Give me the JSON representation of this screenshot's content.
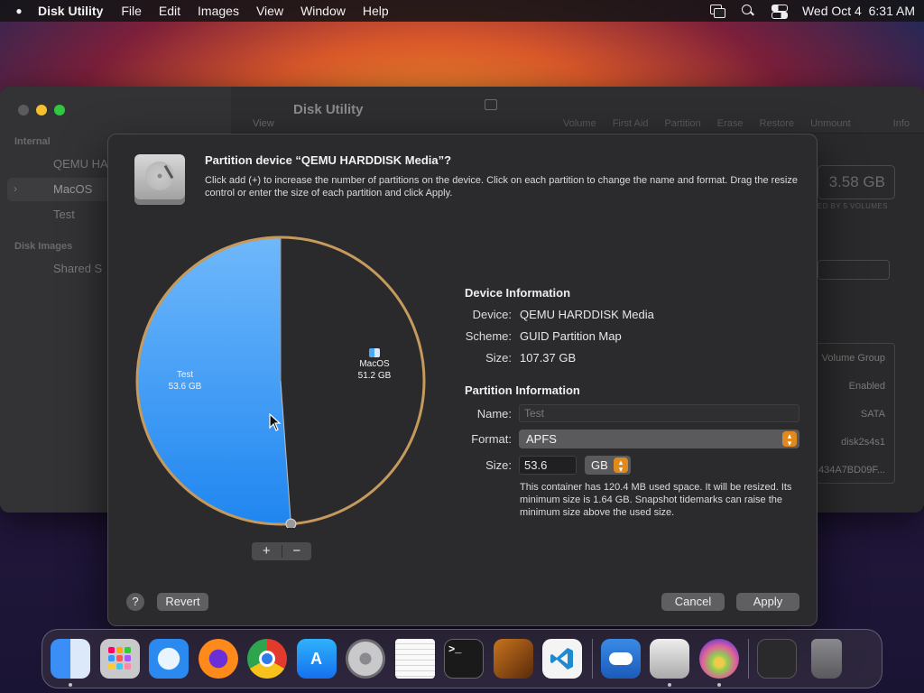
{
  "menubar": {
    "app_name": "Disk Utility",
    "items": [
      "File",
      "Edit",
      "Images",
      "View",
      "Window",
      "Help"
    ],
    "clock": "Wed Oct 4  6:31 AM"
  },
  "background_window": {
    "title": "Disk Utility",
    "view_label": "View",
    "toolbar_items": [
      "Volume",
      "First Aid",
      "Partition",
      "Erase",
      "Restore",
      "Unmount"
    ],
    "info_label": "Info",
    "sidebar": {
      "internal_header": "Internal",
      "items": [
        "QEMU HA",
        "MacOS",
        "Test"
      ],
      "images_header": "Disk Images",
      "image_items": [
        "Shared S"
      ]
    },
    "capacity_text": "3.58 GB",
    "shared_text": "ED BY 5 VOLUMES",
    "info_cells": [
      "Volume Group",
      "Enabled",
      "SATA",
      "disk2s4s1",
      "434A7BD09F..."
    ]
  },
  "sheet": {
    "title": "Partition device “QEMU HARDDISK Media”?",
    "description": "Click add (+) to increase the number of partitions on the device. Click on each partition to change the name and format. Drag the resize control or enter the size of each partition and click Apply.",
    "device_info_header": "Device Information",
    "device_label": "Device:",
    "device_value": "QEMU HARDDISK Media",
    "scheme_label": "Scheme:",
    "scheme_value": "GUID Partition Map",
    "size_label": "Size:",
    "size_value": "107.37 GB",
    "partition_info_header": "Partition Information",
    "name_label": "Name:",
    "name_placeholder": "Test",
    "format_label": "Format:",
    "format_value": "APFS",
    "psize_label": "Size:",
    "psize_value": "53.6",
    "unit_value": "GB",
    "size_note": "This container has 120.4 MB used space. It will be resized. Its minimum size is 1.64 GB. Snapshot tidemarks can raise the minimum size above the used size.",
    "plus": "+",
    "minus": "−",
    "help": "?",
    "revert": "Revert",
    "cancel": "Cancel",
    "apply": "Apply"
  },
  "partitions": [
    {
      "name": "Test",
      "size": "53.6 GB",
      "size_gb": 53.6,
      "color": "#3a9cf5"
    },
    {
      "name": "MacOS",
      "size": "51.2 GB",
      "size_gb": 51.2,
      "color": "#2a2a2c"
    }
  ],
  "dock": {
    "apps": [
      "Finder",
      "Launchpad",
      "Safari",
      "Firefox",
      "Chrome",
      "App Store",
      "System Preferences",
      "TextEdit",
      "Terminal",
      "GarageBand",
      "Visual Studio Code"
    ],
    "extras": [
      "Weather",
      "Disk Utility",
      "Siri"
    ],
    "trash": [
      "Folder",
      "Trash"
    ]
  }
}
